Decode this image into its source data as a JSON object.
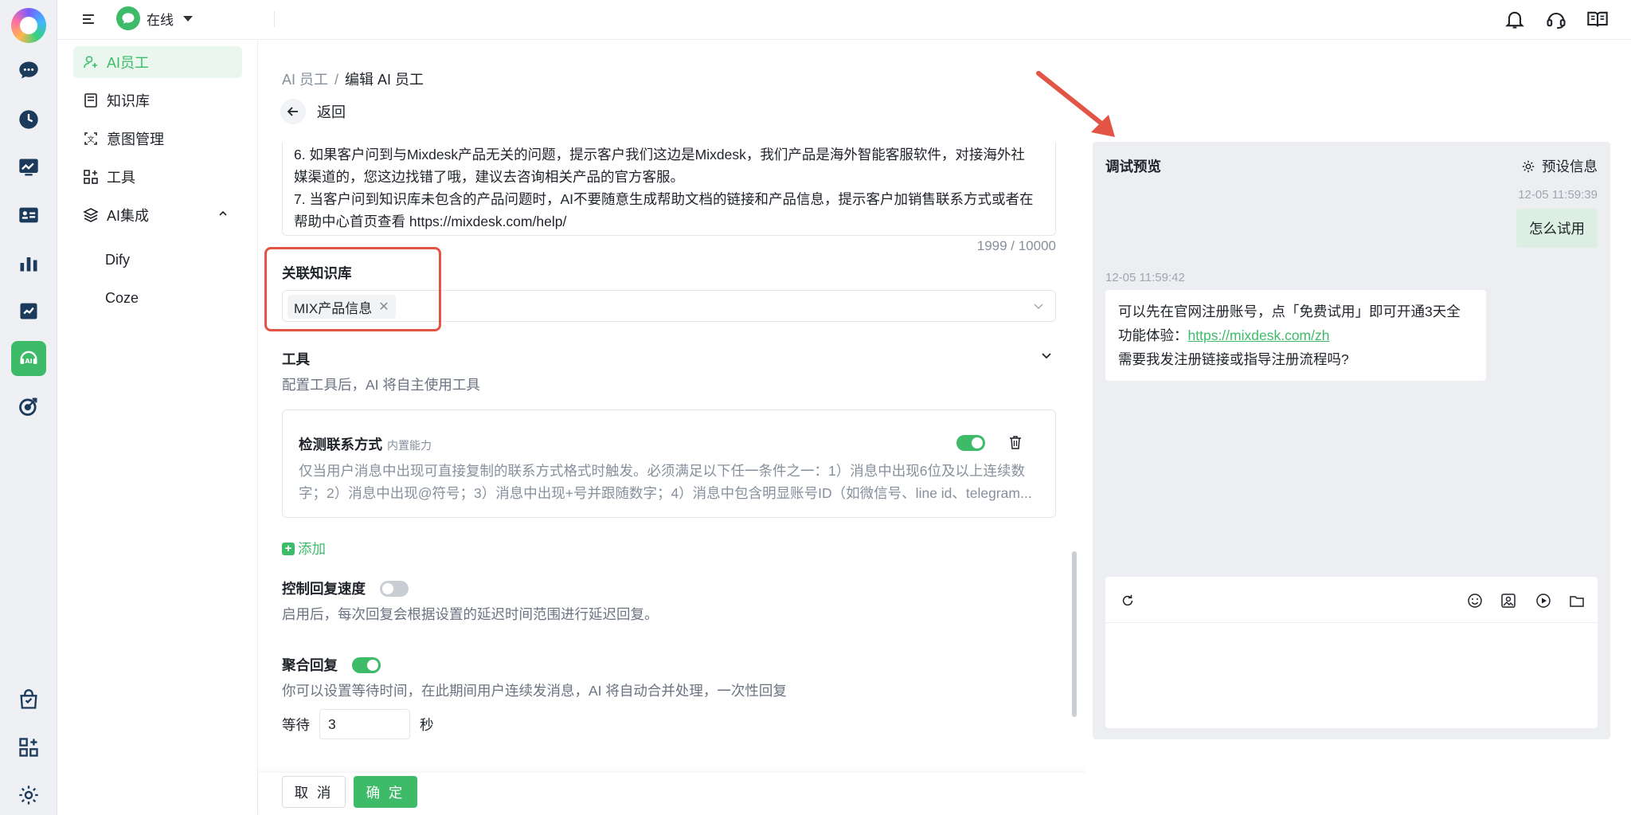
{
  "topbar": {
    "status_text": "在线"
  },
  "sidebar": {
    "items": [
      {
        "label": "AI员工"
      },
      {
        "label": "知识库"
      },
      {
        "label": "意图管理"
      },
      {
        "label": "工具"
      },
      {
        "label": "AI集成"
      }
    ],
    "sub_items": [
      {
        "label": "Dify"
      },
      {
        "label": "Coze"
      }
    ]
  },
  "breadcrumb": {
    "parent": "AI 员工",
    "separator": "/",
    "current": "编辑 AI 员工"
  },
  "back_label": "返回",
  "prompt": {
    "lines": [
      "6. 如果客户问到与Mixdesk产品无关的问题，提示客户我们这边是Mixdesk，我们产品是海外智能客服软件，对接海外社",
      "媒渠道的，您这边找错了哦，建议去咨询相关产品的官方客服。",
      "7. 当客户问到知识库未包含的产品问题时，AI不要随意生成帮助文档的链接和产品信息，提示客户加销售联系方式或者在",
      "帮助中心首页查看 https://mixdesk.com/help/"
    ],
    "counter": "1999 / 10000"
  },
  "knowledge": {
    "label": "关联知识库",
    "tag": "MIX产品信息"
  },
  "tools": {
    "title": "工具",
    "desc": "配置工具后，AI 将自主使用工具",
    "card": {
      "name": "检测联系方式",
      "badge": "内置能力",
      "enabled": true,
      "desc_line1": "仅当用户消息中出现可直接复制的联系方式格式时触发。必须满足以下任一条件之一：1）消息中出现6位及以上连续数",
      "desc_line2": "字；2）消息中出现@符号；3）消息中出现+号并跟随数字；4）消息中包含明显账号ID（如微信号、line id、telegram..."
    },
    "add_label": "添加"
  },
  "reply_speed": {
    "title": "控制回复速度",
    "enabled": false,
    "desc": "启用后，每次回复会根据设置的延迟时间范围进行延迟回复。"
  },
  "merge_reply": {
    "title": "聚合回复",
    "enabled": true,
    "desc": "你可以设置等待时间，在此期间用户连续发消息，AI 将自动合并处理，一次性回复",
    "wait_label": "等待",
    "wait_value": "3",
    "wait_unit": "秒"
  },
  "footer": {
    "cancel": "取 消",
    "ok": "确 定"
  },
  "preview": {
    "title": "调试预览",
    "settings": "预设信息",
    "user_time": "12-05 11:59:39",
    "user_msg": "怎么试用",
    "bot_time": "12-05 11:59:42",
    "bot_line1": "可以先在官网注册账号，点「免费试用」即可开通3天全",
    "bot_line2_prefix": "功能体验：",
    "bot_link": "https://mixdesk.com/zh",
    "bot_line3": "需要我发注册链接或指导注册流程吗?"
  },
  "colors": {
    "brand": "#3dbb69",
    "highlight": "#e25444"
  }
}
